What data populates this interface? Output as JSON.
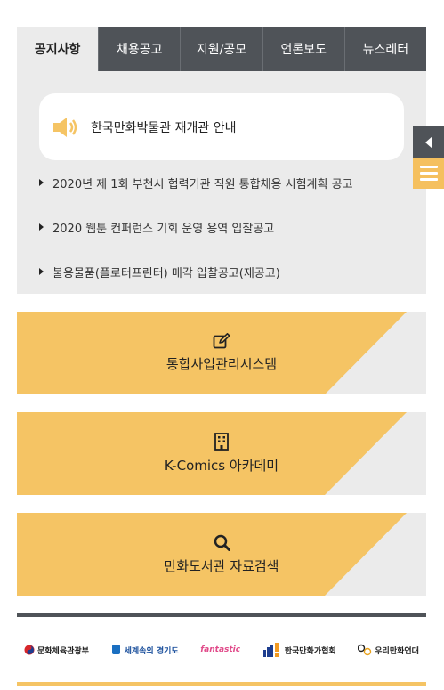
{
  "tabs": [
    {
      "label": "공지사항",
      "active": true
    },
    {
      "label": "채용공고",
      "active": false
    },
    {
      "label": "지원/공모",
      "active": false
    },
    {
      "label": "언론보도",
      "active": false
    },
    {
      "label": "뉴스레터",
      "active": false
    }
  ],
  "notice": {
    "icon": "speaker-icon",
    "text": "한국만화박물관 재개관 안내"
  },
  "news": [
    "2020년 제 1회 부천시 협력기관 직원 통합채용 시험계획 공고",
    "2020 웹툰 컨퍼런스 기회 운영 용역 입찰공고",
    "불용물품(플로터프린터) 매각 입찰공고(재공고)"
  ],
  "banners": [
    {
      "icon": "edit-icon",
      "label": "통합사업관리시스템"
    },
    {
      "icon": "building-icon",
      "label": "K-Comics 아카데미"
    },
    {
      "icon": "search-icon",
      "label": "만화도서관 자료검색"
    }
  ],
  "logos": [
    {
      "name": "ministry-culture-logo",
      "text": "문화체육관광부"
    },
    {
      "name": "gyeonggi-logo",
      "text": "세계속의 경기도"
    },
    {
      "name": "fantastic-bucheon-logo",
      "text": "fantastic"
    },
    {
      "name": "kcartoonist-logo",
      "text": "한국만화가협회"
    },
    {
      "name": "woori-manhwa-logo",
      "text": "우리만화연대"
    }
  ],
  "colors": {
    "accent": "#f5c464",
    "dark": "#4f5358",
    "panel": "#ebebeb"
  }
}
